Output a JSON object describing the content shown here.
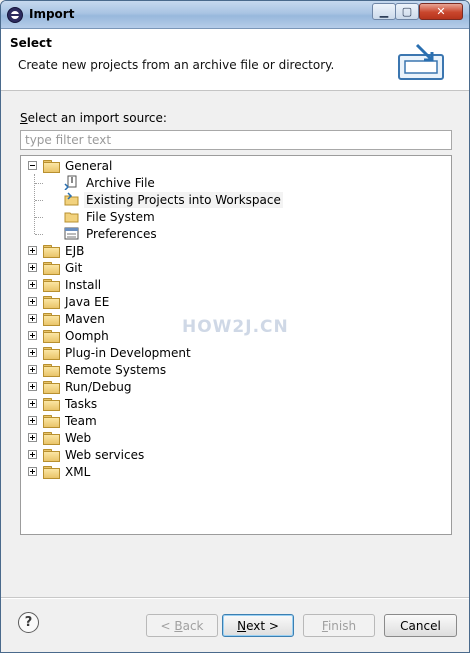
{
  "window": {
    "title": "Import"
  },
  "header": {
    "title": "Select",
    "description": "Create new projects from an archive file or directory."
  },
  "source": {
    "label_mnemonic": "S",
    "label_rest": "elect an import source:",
    "filter_placeholder": "type filter text",
    "filter_value": ""
  },
  "tree": {
    "general": {
      "label": "General",
      "children": [
        "Archive File",
        "Existing Projects into Workspace",
        "File System",
        "Preferences"
      ]
    },
    "categories": [
      "EJB",
      "Git",
      "Install",
      "Java EE",
      "Maven",
      "Oomph",
      "Plug-in Development",
      "Remote Systems",
      "Run/Debug",
      "Tasks",
      "Team",
      "Web",
      "Web services",
      "XML"
    ]
  },
  "watermark": "HOW2J.CN",
  "footer": {
    "help": "?",
    "back_mnemonic": "B",
    "back_rest": "ack",
    "back_prefix": "< ",
    "next_mnemonic": "N",
    "next_rest": "ext >",
    "finish_mnemonic": "F",
    "finish_rest": "inish",
    "cancel": "Cancel"
  },
  "colors": {
    "accent": "#3c7fb1",
    "titlebar": "#a9c4e3"
  }
}
